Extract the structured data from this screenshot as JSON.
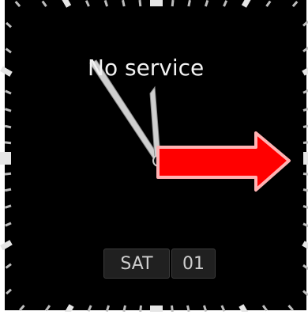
{
  "watch": {
    "status_text": "No service",
    "weekday": "SAT",
    "day": "01",
    "hands": {
      "hour_angle_deg": -10,
      "minute_angle_deg": -36
    },
    "colors": {
      "face": "#000000",
      "frame": "#ffffff",
      "tick": "#d8d8d8",
      "hand": "#d0d0d0",
      "arrow_fill": "#ff0000",
      "arrow_outline": "#ffb3b3"
    },
    "icons": [
      "overlay-arrow-right-icon"
    ]
  }
}
